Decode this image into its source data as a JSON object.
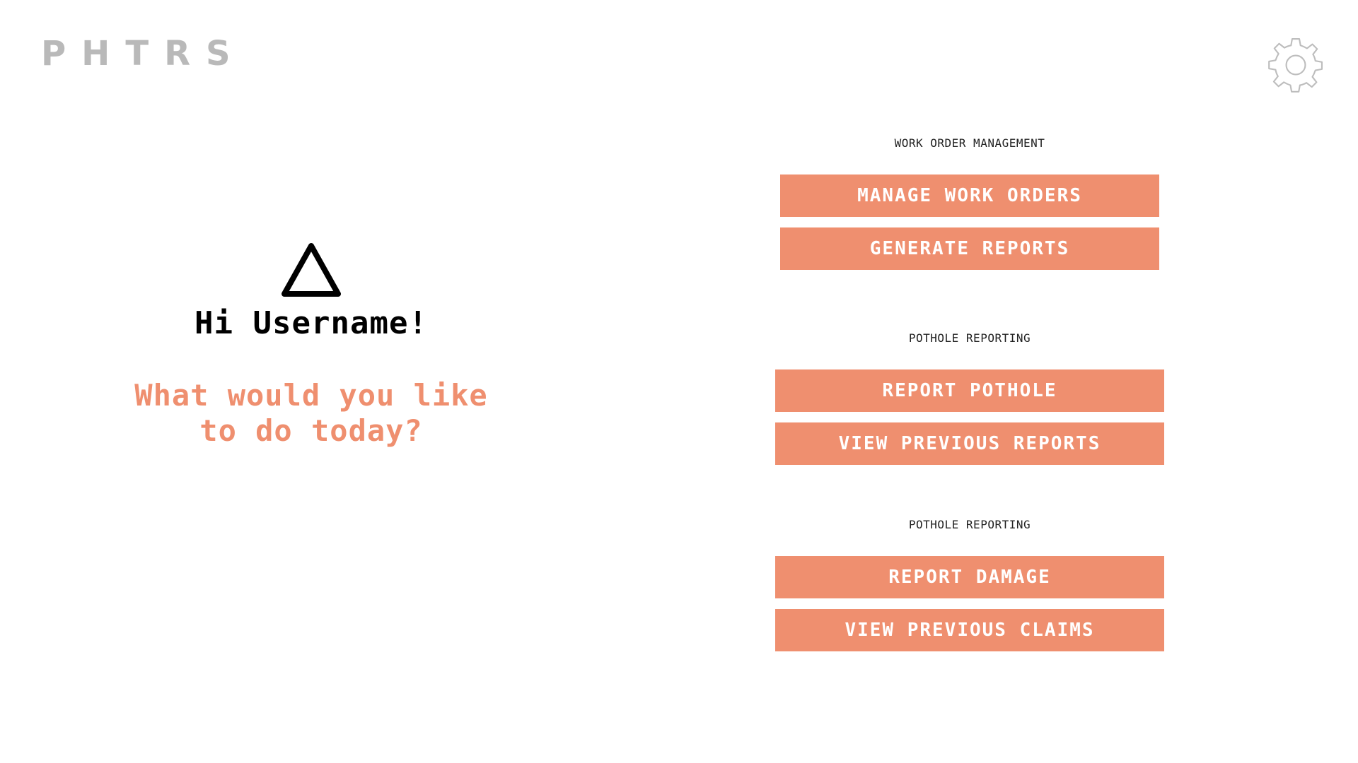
{
  "app": {
    "logo_text": "PHTRS"
  },
  "header": {
    "settings_icon": "gear-icon"
  },
  "greeting": {
    "icon": "triangle-icon",
    "text": "Hi Username!",
    "question": "What would you like to do today?"
  },
  "sections": [
    {
      "label": "WORK ORDER MANAGEMENT",
      "buttons": [
        {
          "label": "MANAGE WORK ORDERS"
        },
        {
          "label": "GENERATE REPORTS"
        }
      ]
    },
    {
      "label": "POTHOLE REPORTING",
      "buttons": [
        {
          "label": "REPORT POTHOLE"
        },
        {
          "label": "VIEW PREVIOUS REPORTS"
        }
      ]
    },
    {
      "label": "POTHOLE REPORTING",
      "buttons": [
        {
          "label": "REPORT DAMAGE"
        },
        {
          "label": "VIEW PREVIOUS CLAIMS"
        }
      ]
    }
  ],
  "colors": {
    "accent": "#ef8f6f",
    "logo": "#b9b9b9",
    "text": "#000000"
  }
}
